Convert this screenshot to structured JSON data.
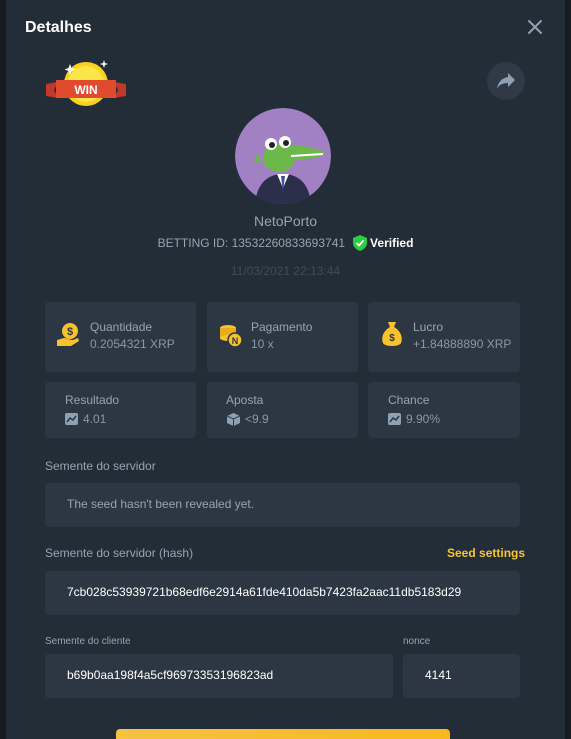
{
  "header": {
    "title": "Detalhes"
  },
  "badge": {
    "text": "WIN"
  },
  "player": {
    "username": "NetoPorto",
    "betting_id": "BETTING ID: 13532260833693741",
    "verified_label": "Verified",
    "date": "11/03/2021 22:13:44"
  },
  "stats": [
    {
      "label": "Quantidade",
      "value": "0.2054321 XRP",
      "icon": "money-hand-icon"
    },
    {
      "label": "Pagamento",
      "value": "10 x",
      "icon": "coin-stack-icon"
    },
    {
      "label": "Lucro",
      "value": "+1.84888890 XRP",
      "icon": "money-bag-icon"
    },
    {
      "label": "Resultado",
      "value": "4.01",
      "icon": "result-icon"
    },
    {
      "label": "Aposta",
      "value": "<9.9",
      "icon": "cube-icon"
    },
    {
      "label": "Chance",
      "value": "9.90%",
      "icon": "chance-icon"
    }
  ],
  "server_seed": {
    "label": "Semente do servidor",
    "value": "The seed hasn't been revealed yet."
  },
  "server_seed_hash": {
    "label": "Semente do servidor (hash)",
    "settings_label": "Seed settings",
    "value": "7cb028c53939721b68edf6e2914a61fde410da5b7423fa2aac11db5183d29"
  },
  "client_seed": {
    "label": "Semente do cliente",
    "value": "b69b0aa198f4a5cf96973353196823ad"
  },
  "nonce": {
    "label": "nonce",
    "value": "4141"
  },
  "colors": {
    "background": "#232d37",
    "card": "#2c3743",
    "accent": "#f7c531",
    "verified": "#2ecc40"
  }
}
